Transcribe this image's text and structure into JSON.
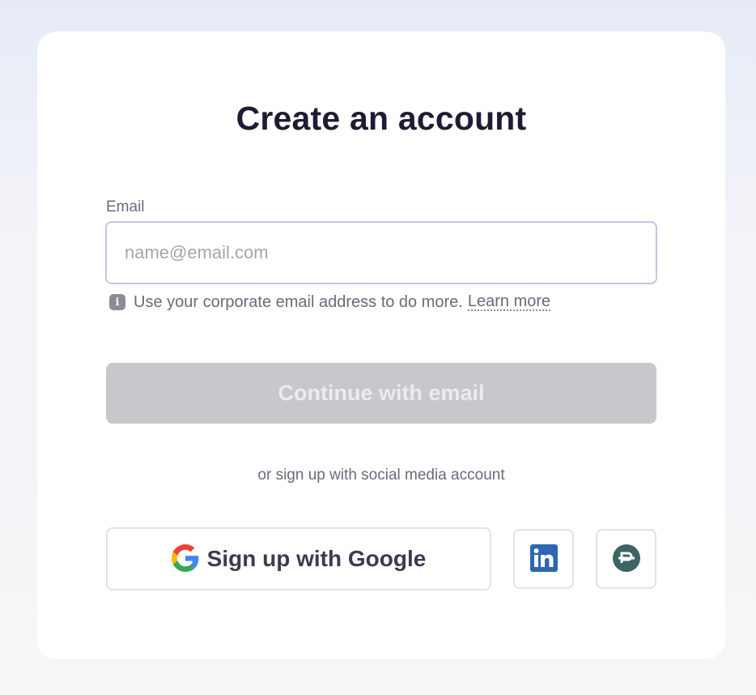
{
  "title": "Create an account",
  "email": {
    "label": "Email",
    "placeholder": "name@email.com",
    "value": ""
  },
  "hint": {
    "text": "Use your corporate email address to do more.",
    "link": "Learn more"
  },
  "continue_button": "Continue with email",
  "divider_text": "or sign up with social media account",
  "social": {
    "google_label": "Sign up with Google",
    "linkedin_icon": "linkedin-icon",
    "other_icon": "circle-p-icon"
  },
  "colors": {
    "title": "#1e1c33",
    "input_border": "#cbc4e4",
    "button_disabled": "#c8c7cc",
    "linkedin": "#2e66b3",
    "other_brand": "#3d6363"
  }
}
